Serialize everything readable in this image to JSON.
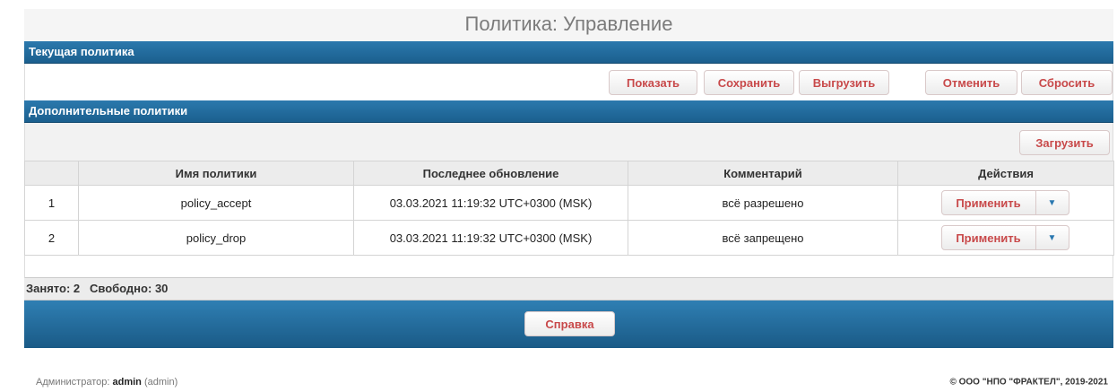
{
  "page_title": "Политика: Управление",
  "current_policy": {
    "header": "Текущая политика",
    "buttons": {
      "show": "Показать",
      "save": "Сохранить",
      "export": "Выгрузить",
      "cancel": "Отменить",
      "reset": "Сбросить"
    }
  },
  "additional_policies": {
    "header": "Дополнительные политики",
    "load_button": "Загрузить",
    "columns": [
      "",
      "Имя политики",
      "Последнее обновление",
      "Комментарий",
      "Действия"
    ],
    "rows": [
      {
        "num": "1",
        "name": "policy_accept",
        "updated": "03.03.2021 11:19:32 UTC+0300 (MSK)",
        "comment": "всё разрешено",
        "action": "Применить"
      },
      {
        "num": "2",
        "name": "policy_drop",
        "updated": "03.03.2021 11:19:32 UTC+0300 (MSK)",
        "comment": "всё запрещено",
        "action": "Применить"
      }
    ]
  },
  "status": {
    "used_label": "Занято:",
    "used_value": "2",
    "free_label": "Свободно:",
    "free_value": "30"
  },
  "help_button": "Справка",
  "footer": {
    "admin_label": "Администратор:",
    "admin_name": "admin",
    "admin_role": "(admin)",
    "copyright": "© ООО \"НПО \"ФРАКТЕЛ\", 2019-2021"
  },
  "icons": {
    "dropdown": "caret-down-icon"
  },
  "colors": {
    "header_blue": "#1f6899",
    "button_text": "#c8494a",
    "caret_blue": "#2a78b0"
  }
}
